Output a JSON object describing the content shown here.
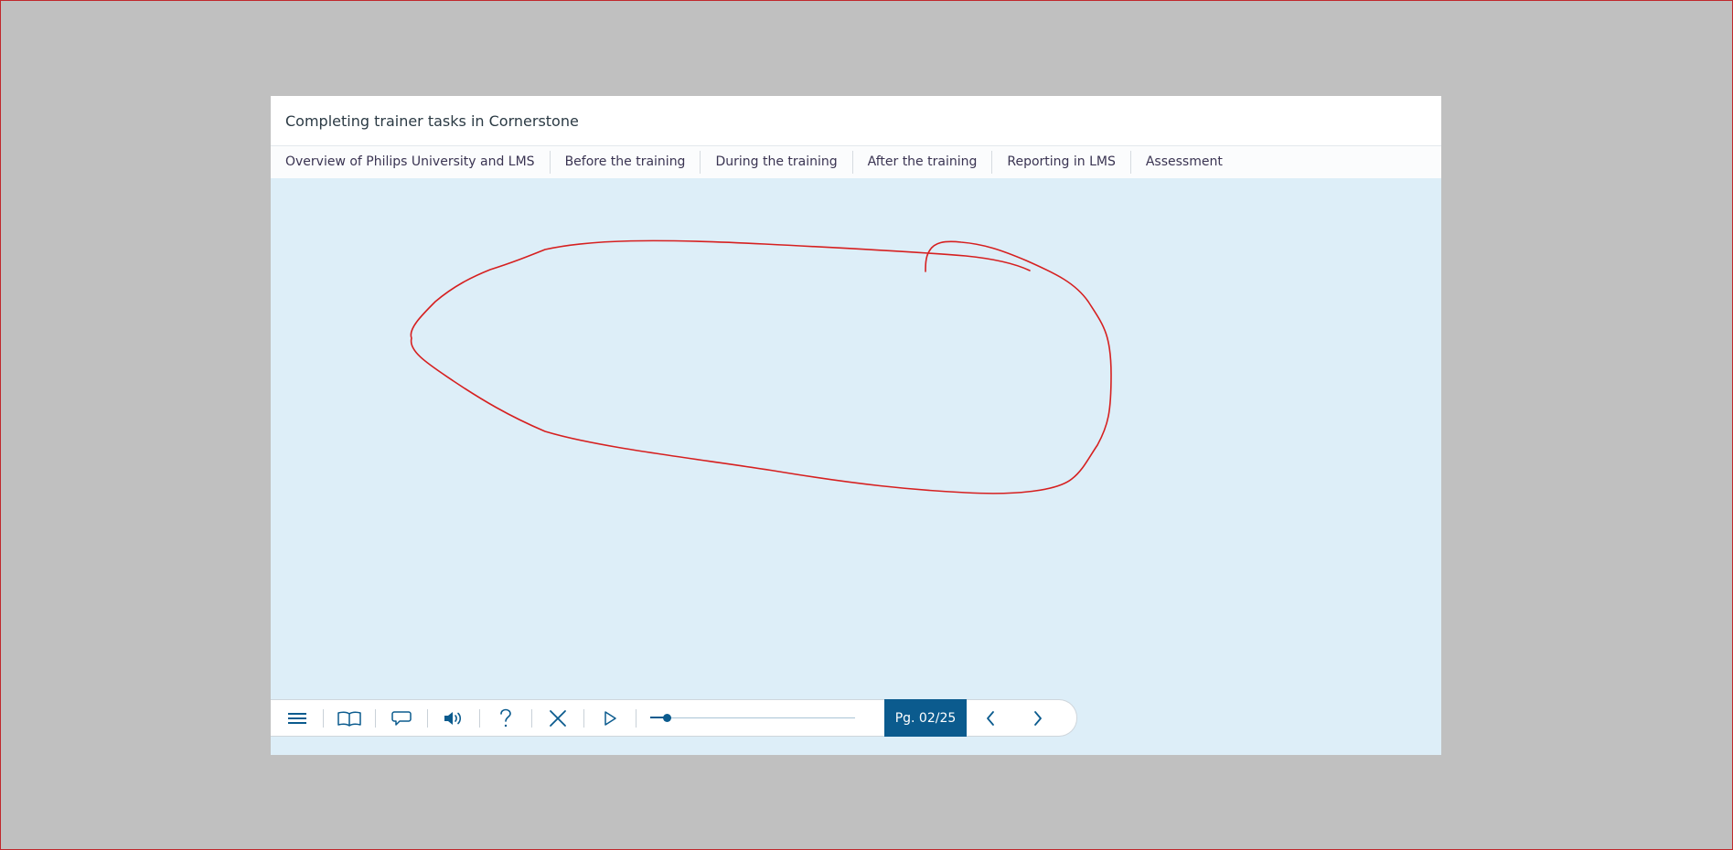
{
  "course": {
    "title": "Completing trainer tasks in Cornerstone"
  },
  "nav": {
    "items": [
      {
        "label": "Overview of Philips University and LMS"
      },
      {
        "label": "Before the training"
      },
      {
        "label": "During the training"
      },
      {
        "label": "After the training"
      },
      {
        "label": "Reporting in LMS"
      },
      {
        "label": "Assessment"
      }
    ]
  },
  "player": {
    "controls": [
      {
        "icon": "menu-icon"
      },
      {
        "icon": "book-icon"
      },
      {
        "icon": "speech-bubble-icon"
      },
      {
        "icon": "volume-icon"
      },
      {
        "icon": "help-icon"
      },
      {
        "icon": "close-icon"
      },
      {
        "icon": "play-icon"
      }
    ],
    "progress": {
      "fraction": 0.08
    },
    "page_label": "Pg. 02/25",
    "prev_icon": "chevron-left-icon",
    "next_icon": "chevron-right-icon"
  },
  "colors": {
    "page_background": "#c0c0c0",
    "content_background": "#ddeef8",
    "accent": "#0b5b8e",
    "annotation_stroke": "#d62020",
    "outer_border": "#c0282d"
  }
}
